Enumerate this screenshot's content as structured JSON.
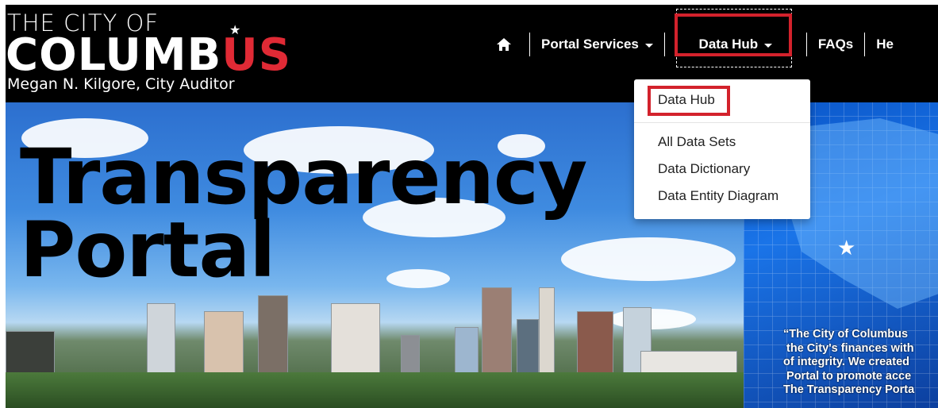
{
  "header": {
    "logo_line1": "THE CITY OF",
    "logo_line2_a": "COLUMB",
    "logo_line2_b": "US",
    "logo_line3": "Megan N. Kilgore, City Auditor"
  },
  "nav": {
    "home_icon": "home-icon",
    "portal_services": "Portal Services",
    "data_hub": "Data Hub",
    "faqs": "FAQs",
    "help_partial": "He"
  },
  "dropdown": {
    "items": [
      "Data Hub",
      "All Data Sets",
      "Data Dictionary",
      "Data Entity Diagram"
    ]
  },
  "hero": {
    "title_line1": "Transparency",
    "title_line2": "Portal",
    "quote": "“The City of Columbus\n the City's finances with\nof integrity. We created\n Portal to promote acce\nThe Transparency Porta"
  },
  "colors": {
    "header_bg": "#000000",
    "accent_red": "#d3222c",
    "logo_us": "#e02a35"
  }
}
